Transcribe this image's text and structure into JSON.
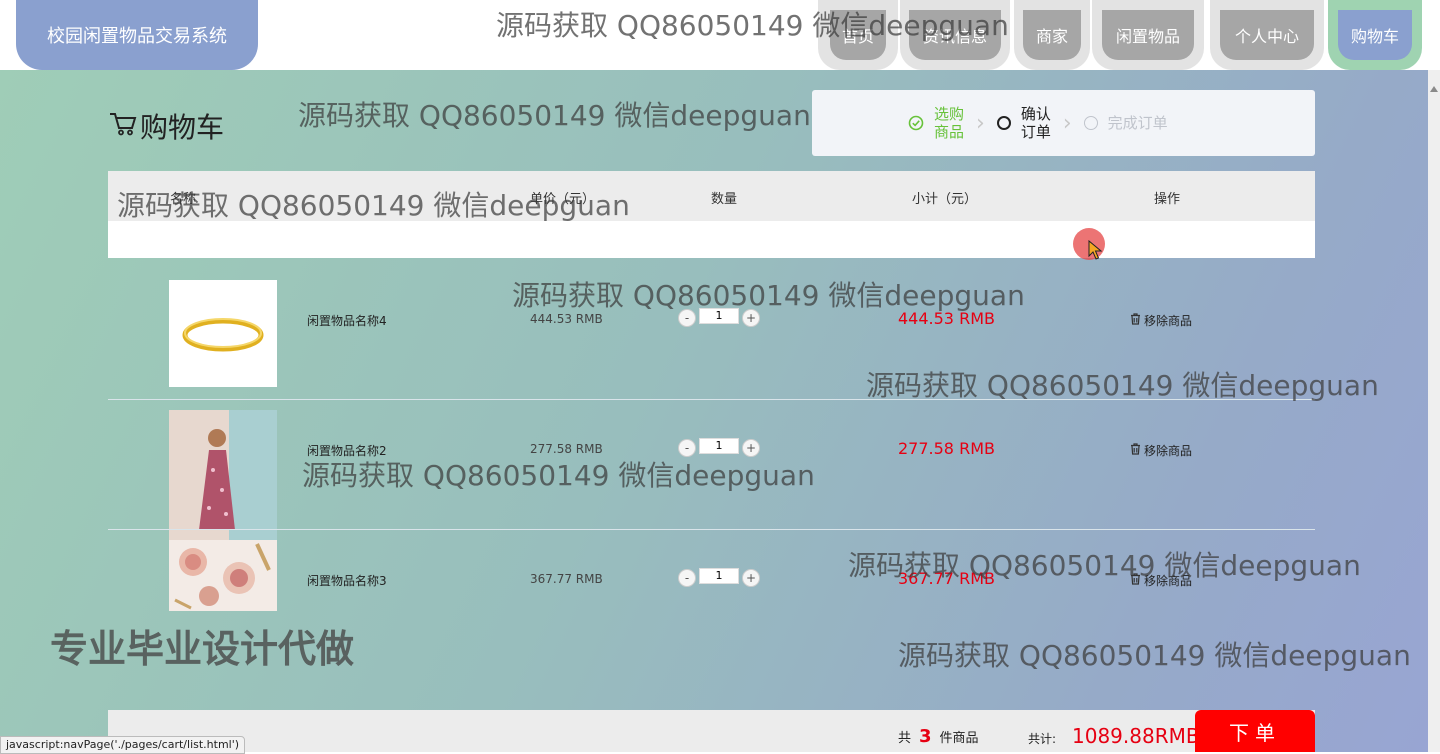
{
  "header": {
    "brand": "校园闲置物品交易系统",
    "nav": [
      "首页",
      "资讯信息",
      "商家",
      "闲置物品",
      "个人中心",
      "购物车"
    ],
    "active_nav": "购物车"
  },
  "cart": {
    "title": "购物车",
    "steps": [
      {
        "label": "选购\n商品",
        "state": "done",
        "color": "#67c23a"
      },
      {
        "label": "确认\n订单",
        "state": "current",
        "color": "#222222"
      },
      {
        "label": "完成订单",
        "state": "pending",
        "color": "#c0c4cc"
      }
    ],
    "columns": [
      "名称",
      "单价（元）",
      "数量",
      "小计（元）",
      "操作"
    ],
    "remove_label": "移除商品",
    "items": [
      {
        "name": "闲置物品名称4",
        "price": "444.53 RMB",
        "qty": "1",
        "subtotal": "444.53 RMB",
        "image": "gold-bangle"
      },
      {
        "name": "闲置物品名称2",
        "price": "277.58 RMB",
        "qty": "1",
        "subtotal": "277.58 RMB",
        "image": "floral-dress"
      },
      {
        "name": "闲置物品名称3",
        "price": "367.77 RMB",
        "qty": "1",
        "subtotal": "367.77 RMB",
        "image": "cosmetics"
      }
    ]
  },
  "summary": {
    "count_prefix": "共",
    "count": "3",
    "count_suffix": "件商品",
    "total_label": "共计:",
    "total": "1089.88RMB",
    "order_button": "下单"
  },
  "watermarks": {
    "text": "源码获取 QQ86050149 微信deepguan",
    "promo": "专业毕业设计代做"
  },
  "statusbar": "javascript:navPage('./pages/cart/list.html')",
  "colors": {
    "accent": "#8aa0cf",
    "active_tab_frame": "#9fd3b1",
    "price_red": "#e60012",
    "order_button": "#ff0000"
  }
}
